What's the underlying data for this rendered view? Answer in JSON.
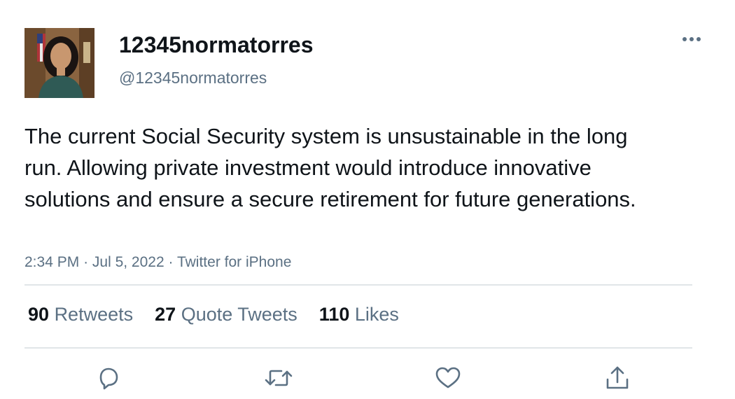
{
  "user": {
    "display_name": "12345normatorres",
    "handle": "@12345normatorres"
  },
  "tweet": {
    "text": "The current Social Security system is unsustainable in the long run. Allowing private investment would introduce innovative solutions and ensure a secure retirement for future generations.",
    "time": "2:34 PM",
    "separator": "·",
    "date": "Jul 5, 2022",
    "source": "Twitter for iPhone"
  },
  "stats": {
    "retweets_count": "90",
    "retweets_label": "Retweets",
    "quotes_count": "27",
    "quotes_label": "Quote Tweets",
    "likes_count": "110",
    "likes_label": "Likes"
  },
  "icons": {
    "more": "more-horizontal-icon",
    "reply": "reply-icon",
    "retweet": "retweet-icon",
    "like": "heart-icon",
    "share": "share-icon"
  },
  "colors": {
    "text_primary": "#0f1419",
    "text_secondary": "#5b7083",
    "divider": "#e1e5e8",
    "icon": "#5b7083"
  }
}
